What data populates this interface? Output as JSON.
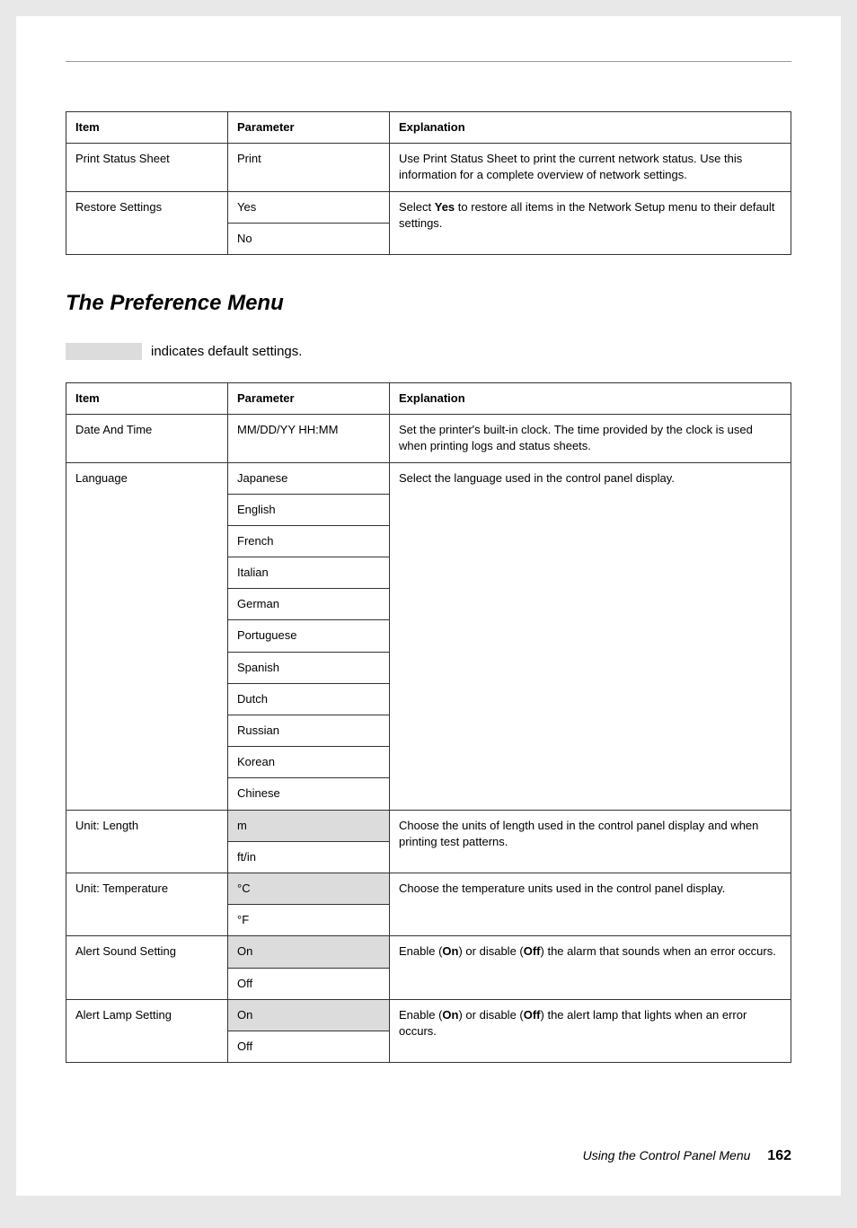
{
  "table1": {
    "headers": {
      "item": "Item",
      "parameter": "Parameter",
      "explanation": "Explanation"
    },
    "rows": [
      {
        "item": "Print Status Sheet",
        "params": [
          {
            "text": "Print",
            "default": false
          }
        ],
        "explanation_parts": [
          "Use Print Status Sheet to print the current network status. Use this information for a complete overview of network settings."
        ]
      },
      {
        "item": "Restore Settings",
        "params": [
          {
            "text": "Yes",
            "default": false
          },
          {
            "text": "No",
            "default": false
          }
        ],
        "explanation_parts": [
          "Select ",
          {
            "b": "Yes"
          },
          " to restore all items in the Network Setup menu to their default settings."
        ]
      }
    ]
  },
  "section_title": "The Preference Menu",
  "legend_text": " indicates default settings.",
  "table2": {
    "headers": {
      "item": "Item",
      "parameter": "Parameter",
      "explanation": "Explanation"
    },
    "rows": [
      {
        "item": "Date And Time",
        "params": [
          {
            "text": "MM/DD/YY HH:MM",
            "default": false
          }
        ],
        "explanation_parts": [
          "Set the printer's built-in clock. The time provided by the clock is used when printing logs and status sheets."
        ]
      },
      {
        "item": "Language",
        "params": [
          {
            "text": "Japanese",
            "default": false
          },
          {
            "text": "English",
            "default": false
          },
          {
            "text": "French",
            "default": false
          },
          {
            "text": "Italian",
            "default": false
          },
          {
            "text": "German",
            "default": false
          },
          {
            "text": "Portuguese",
            "default": false
          },
          {
            "text": "Spanish",
            "default": false
          },
          {
            "text": "Dutch",
            "default": false
          },
          {
            "text": "Russian",
            "default": false
          },
          {
            "text": "Korean",
            "default": false
          },
          {
            "text": "Chinese",
            "default": false
          }
        ],
        "explanation_parts": [
          "Select the language used in the control panel display."
        ]
      },
      {
        "item": "Unit: Length",
        "params": [
          {
            "text": "m",
            "default": true
          },
          {
            "text": "ft/in",
            "default": false
          }
        ],
        "explanation_parts": [
          "Choose the units of length used in the control panel display and when printing test patterns."
        ]
      },
      {
        "item": "Unit: Temperature",
        "params": [
          {
            "text": "°C",
            "default": true
          },
          {
            "text": "°F",
            "default": false
          }
        ],
        "explanation_parts": [
          "Choose the temperature units used in the control panel display."
        ]
      },
      {
        "item": "Alert Sound Setting",
        "params": [
          {
            "text": "On",
            "default": true
          },
          {
            "text": "Off",
            "default": false
          }
        ],
        "explanation_parts": [
          "Enable (",
          {
            "b": "On"
          },
          ") or disable (",
          {
            "b": "Off"
          },
          ") the alarm that sounds when an error occurs."
        ]
      },
      {
        "item": "Alert Lamp Setting",
        "params": [
          {
            "text": "On",
            "default": true
          },
          {
            "text": "Off",
            "default": false
          }
        ],
        "explanation_parts": [
          "Enable (",
          {
            "b": "On"
          },
          ") or disable (",
          {
            "b": "Off"
          },
          ") the alert lamp that lights when an error occurs."
        ]
      }
    ]
  },
  "footer": {
    "section": "Using the Control Panel Menu",
    "page": "162"
  }
}
